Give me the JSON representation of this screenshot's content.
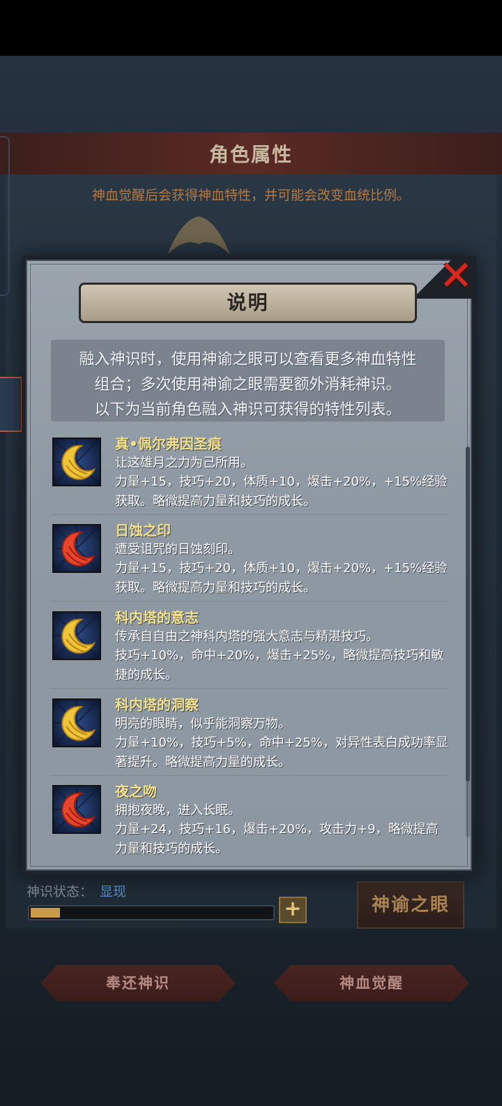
{
  "background": {
    "title": "角色属性",
    "subtitle": "神血觉醒后会获得神血特性，并可能会改变血统比例。",
    "status_label": "神识状态：",
    "status_value": "显现",
    "progress": 0.12,
    "oracle_button": "神谕之眼",
    "plus_icon": "plus-icon",
    "buttons": {
      "return": "奉还神识",
      "awaken": "神血觉醒"
    }
  },
  "modal": {
    "title": "说明",
    "close_icon": "close-x-icon",
    "intro": [
      "融入神识时，使用神谕之眼可以查看更多神血特性",
      "组合；多次使用神谕之眼需要额外消耗神识。",
      "以下为当前角色融入神识可获得的特性列表。"
    ],
    "traits": [
      {
        "name": "真•佩尔弗因圣痕",
        "desc": "让这雄月之力为己所用。",
        "stats": "力量+15，技巧+20，体质+10，爆击+20%，+15%经验获取。略微提高力量和技巧的成长。",
        "icon": "gold-crescent-moon-icon"
      },
      {
        "name": "日蚀之印",
        "desc": "遭受诅咒的日蚀刻印。",
        "stats": "力量+15，技巧+20，体质+10，爆击+20%，+15%经验获取。略微提高力量和技巧的成长。",
        "icon": "red-crescent-moon-icon"
      },
      {
        "name": "科内塔的意志",
        "desc": "传承自自由之神科内塔的强大意志与精湛技巧。",
        "stats": "技巧+10%，命中+20%，爆击+25%，略微提高技巧和敏捷的成长。",
        "icon": "gold-crescent-moon-icon"
      },
      {
        "name": "科内塔的洞察",
        "desc": "明亮的眼睛，似乎能洞察万物。",
        "stats": "力量+10%，技巧+5%，命中+25%，对异性表白成功率显著提升。略微提高力量的成长。",
        "icon": "gold-crescent-moon-icon"
      },
      {
        "name": "夜之吻",
        "desc": "拥抱夜晚，进入长眠。",
        "stats": "力量+24，技巧+16，爆击+20%，攻击力+9，略微提高力量和技巧的成长。",
        "icon": "red-crescent-moon-icon"
      }
    ]
  },
  "colors": {
    "trait_name": "#f2e08a",
    "gold_moon": "#f0c53a",
    "red_moon": "#e8462c",
    "close_x": "#d8291f"
  }
}
